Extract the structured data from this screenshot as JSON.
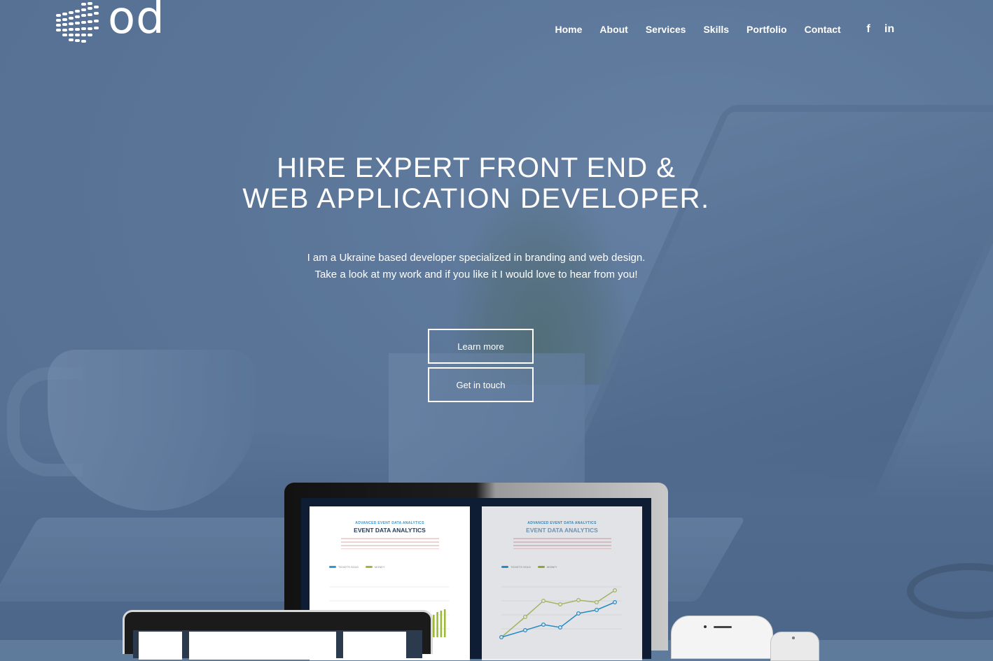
{
  "brand": {
    "logo_text": "od"
  },
  "nav": {
    "items": [
      "Home",
      "About",
      "Services",
      "Skills",
      "Portfolio",
      "Contact"
    ]
  },
  "social": [
    {
      "label": "f",
      "icon": "facebook-icon"
    },
    {
      "label": "in",
      "icon": "linkedin-icon"
    }
  ],
  "hero": {
    "title_line1": "HIRE EXPERT FRONT END &",
    "title_line2": "WEB APPLICATION DEVELOPER.",
    "subtitle_line1": "I am a Ukraine based developer specialized in branding and web design.",
    "subtitle_line2": "Take a look at my work and if you like it I would love to hear from you!",
    "button_primary": "Learn more",
    "button_secondary": "Get in touch"
  },
  "mockup": {
    "left_sheet": {
      "overline": "ADVANCED EVENT DATA ANALYTICS",
      "title": "EVENT DATA ANALYTICS",
      "legend": [
        "TICKETS SOLD",
        "MONEY"
      ]
    },
    "right_sheet": {
      "overline": "ADVANCED EVENT DATA ANALYTICS",
      "title": "EVENT DATA ANALYTICS",
      "legend": [
        "TICKETS SOLD",
        "MONEY"
      ]
    }
  },
  "colors": {
    "overlay": "#546e91",
    "accent_blue": "#2a9bd8",
    "accent_green": "#9cba3a",
    "text": "#ffffff"
  }
}
